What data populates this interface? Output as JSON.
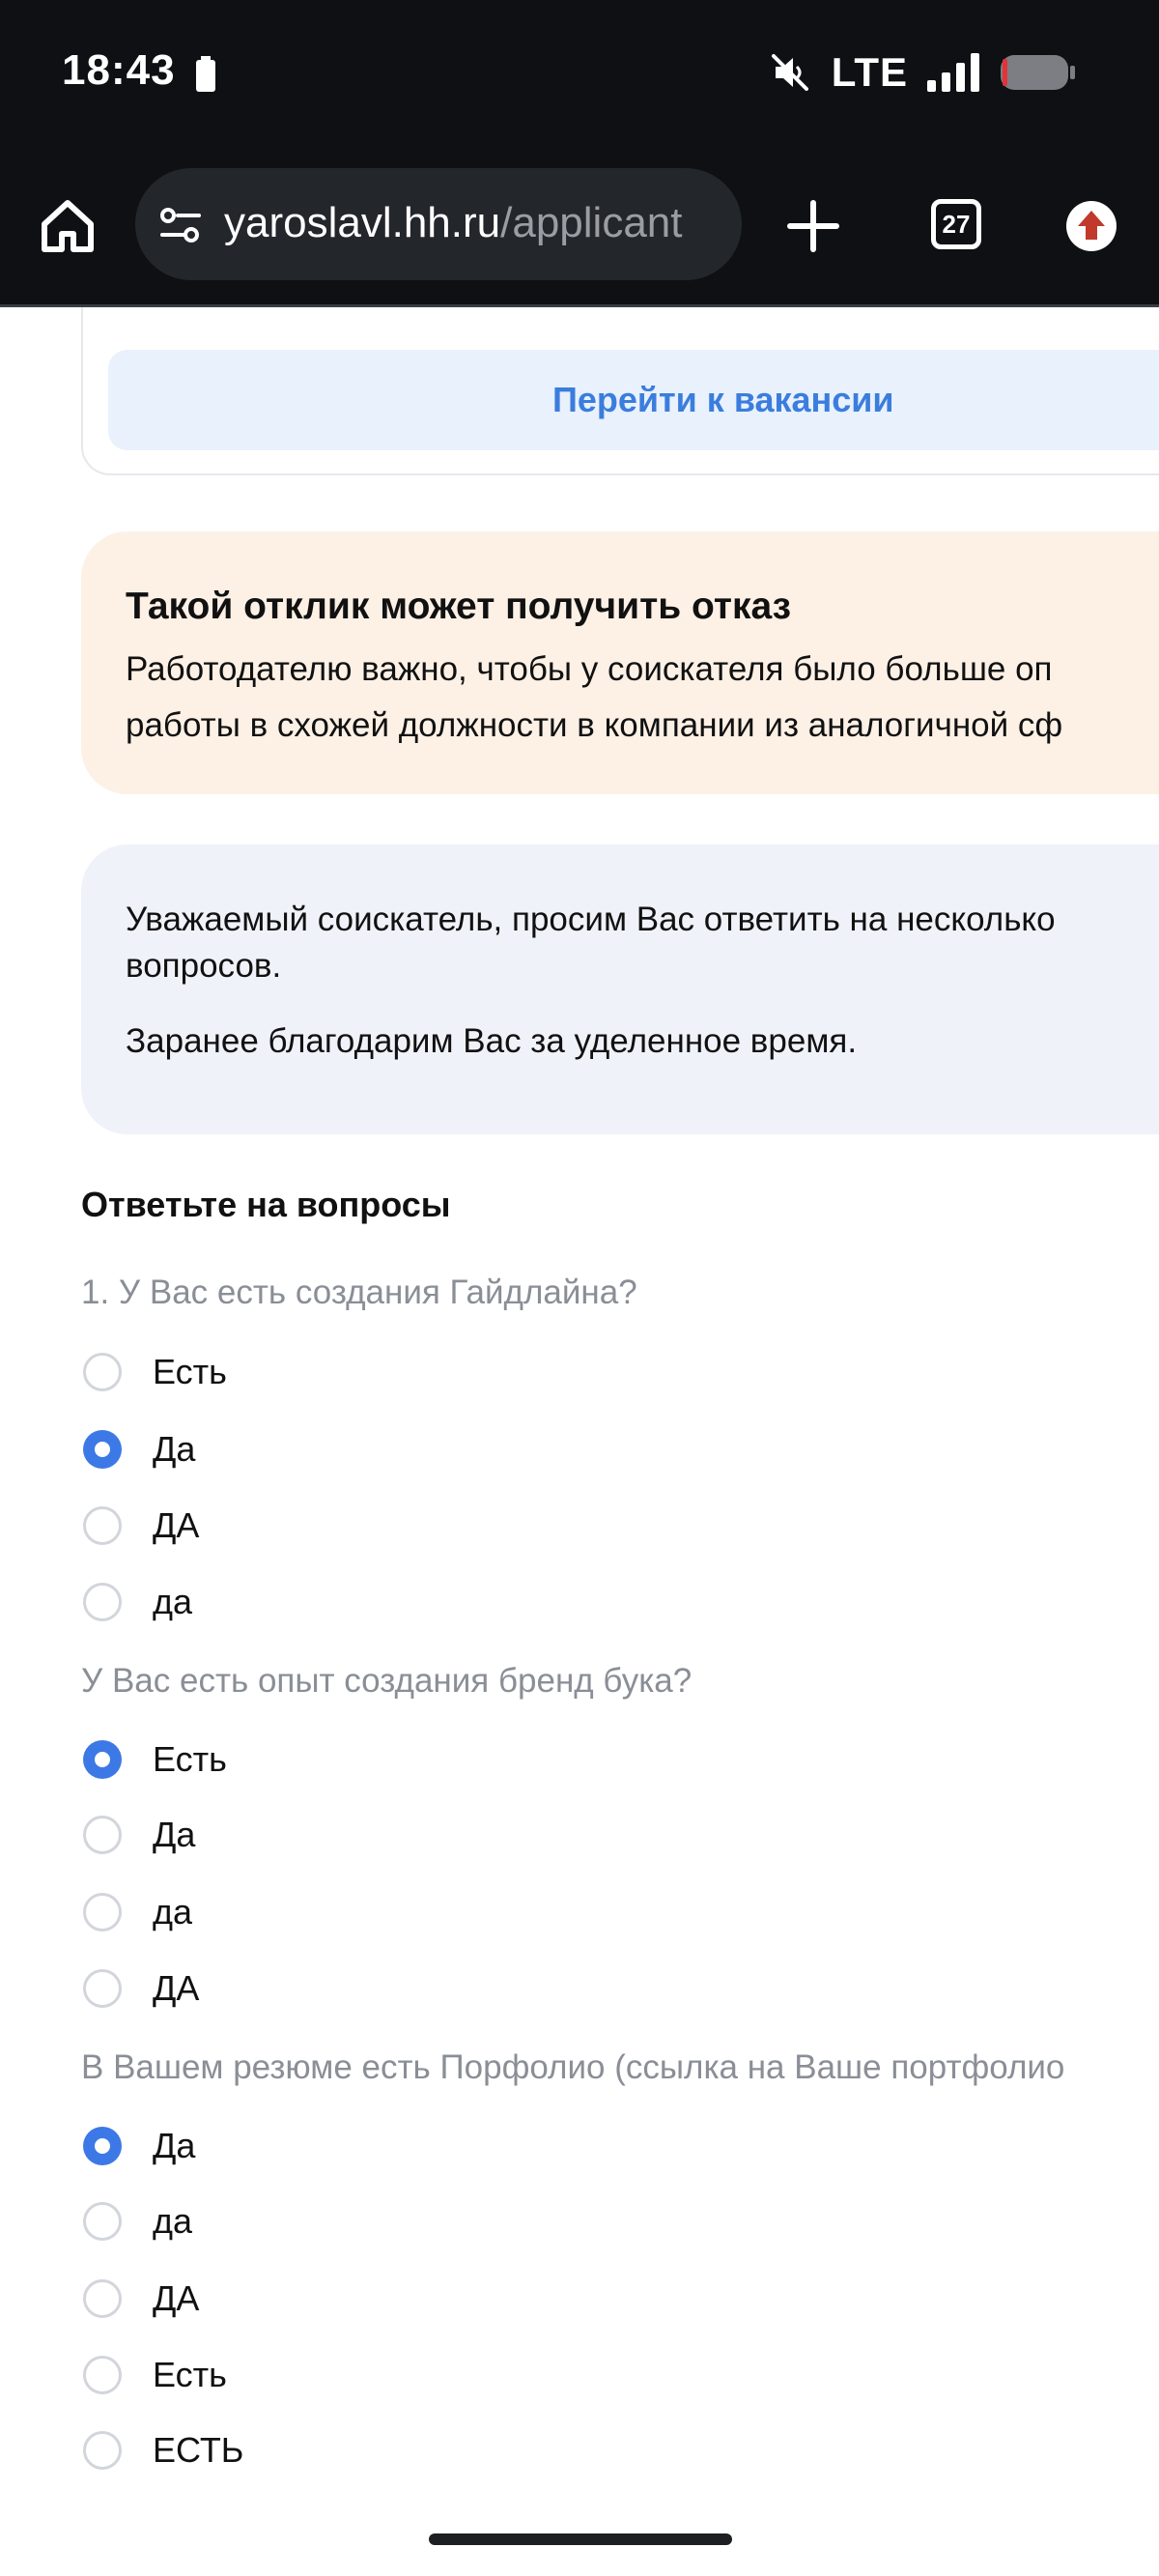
{
  "status": {
    "time": "18:43",
    "network": "LTE"
  },
  "browser": {
    "url_host": "yaroslavl.hh.ru",
    "url_path": "/applicant",
    "tab_count": "27",
    "icons": [
      "home-icon",
      "site-settings-icon",
      "plus-icon",
      "tabs-icon",
      "update-icon"
    ]
  },
  "page": {
    "vacancy_button": "Перейти к вакансии",
    "warning": {
      "title": "Такой отклик может получить отказ",
      "text": "Работодателю важно, чтобы у соискателя было больше оп\nработы в схожей должности в компании из аналогичной сф"
    },
    "info": {
      "text1": "Уважаемый соискатель, просим Вас ответить на несколько\nвопросов.",
      "text2": "Заранее благодарим Вас за уделенное время."
    },
    "questions_title": "Ответьте на вопросы",
    "questions": [
      {
        "label": "1. У Вас есть создания Гайдлайна?",
        "options": [
          {
            "label": "Есть",
            "checked": false
          },
          {
            "label": "Да",
            "checked": true
          },
          {
            "label": "ДА",
            "checked": false
          },
          {
            "label": "да",
            "checked": false
          }
        ]
      },
      {
        "label": "У Вас есть опыт создания бренд бука?",
        "options": [
          {
            "label": "Есть",
            "checked": true
          },
          {
            "label": "Да",
            "checked": false
          },
          {
            "label": "да",
            "checked": false
          },
          {
            "label": "ДА",
            "checked": false
          }
        ]
      },
      {
        "label": "В Вашем резюме есть Порфолио (ссылка на Ваше портфолио",
        "options": [
          {
            "label": "Да",
            "checked": true
          },
          {
            "label": "да",
            "checked": false
          },
          {
            "label": "ДА",
            "checked": false
          },
          {
            "label": "Есть",
            "checked": false
          },
          {
            "label": "ЕСТЬ",
            "checked": false
          }
        ]
      }
    ]
  },
  "colors": {
    "accent": "#3c79e6",
    "link": "#3b7ddd",
    "warning_bg": "#fdf1e6",
    "info_bg": "#f0f2f9",
    "chrome_bg": "#0e1013"
  }
}
